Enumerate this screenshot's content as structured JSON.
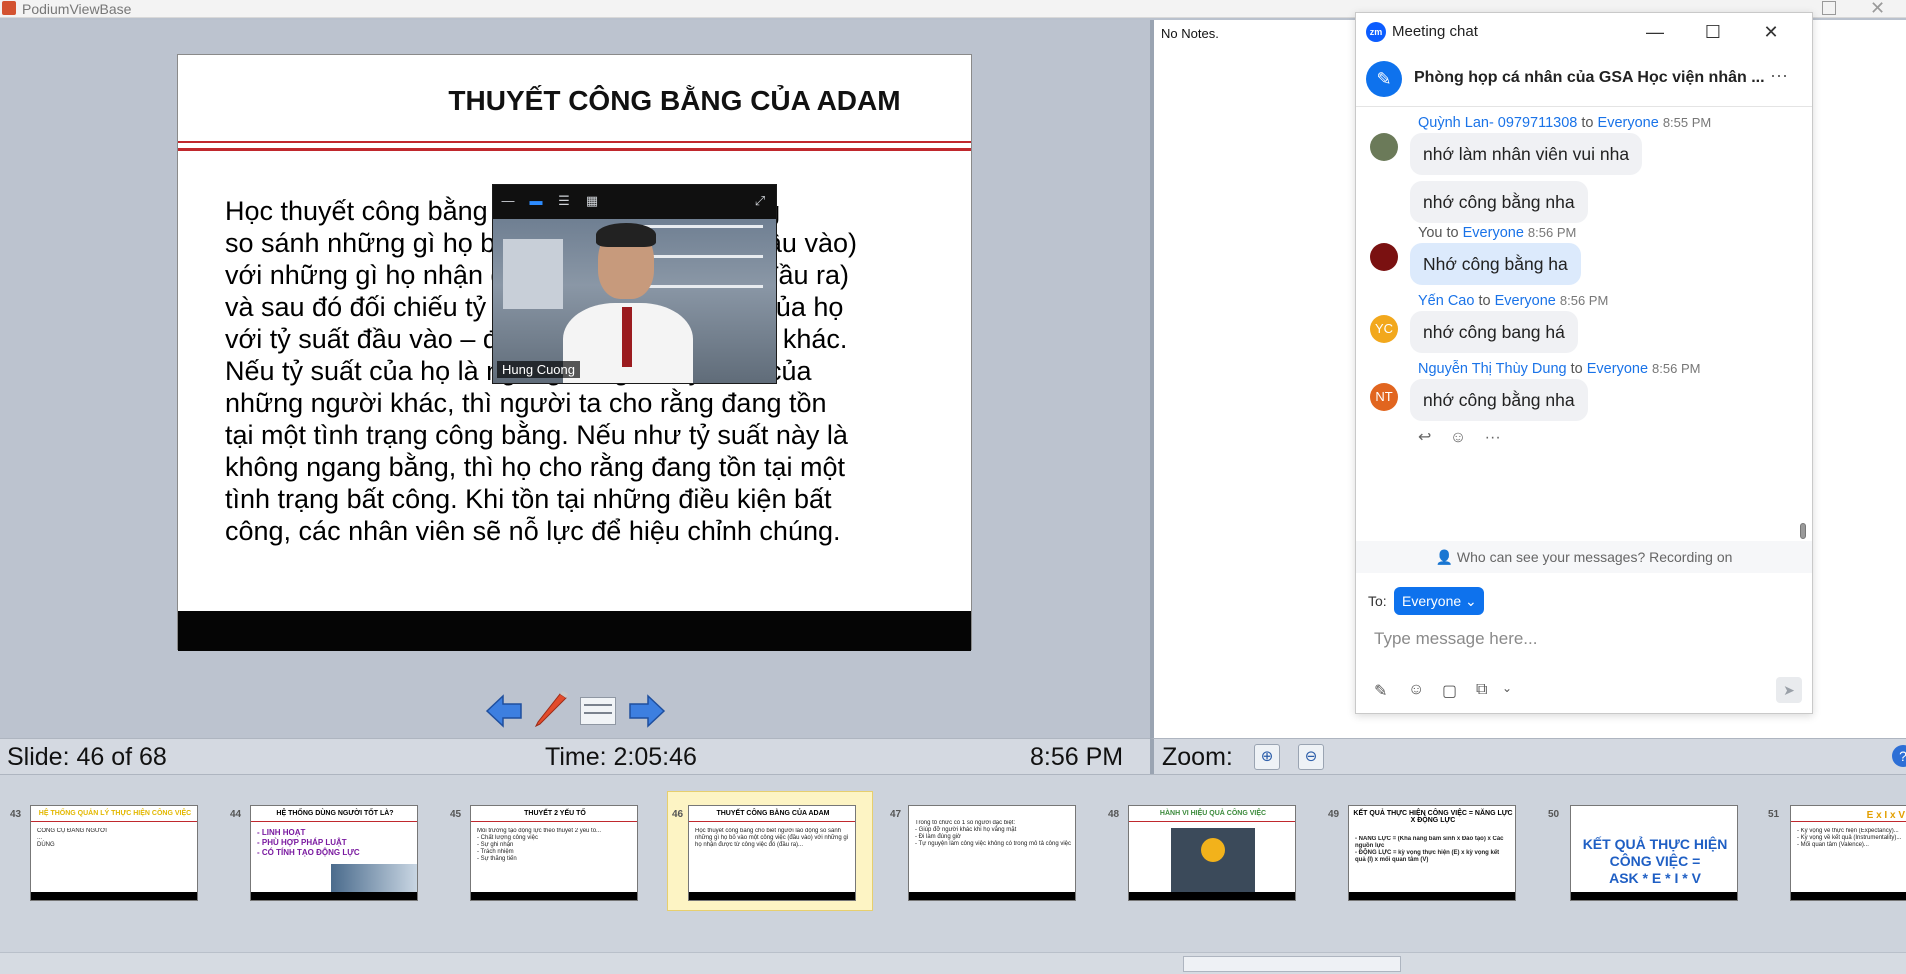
{
  "window": {
    "title": "PodiumViewBase"
  },
  "slide": {
    "title": "THUYẾT CÔNG BẰNG CỦA ADAM",
    "body": "Học thuyết công bằng cho biết người lao động\nso sánh những gì họ bỏ vào một công việc (đầu vào)\nvới những gì họ nhận được từ công việc đó (đầu ra)\nvà sau đó đối chiếu tỷ suất đầu vào – đầu ra của họ\nvới tỷ suất đầu vào – đầu ra của những người khác.\nNếu tỷ suất của họ là ngang bằng với tỷ suất của\nnhững người khác, thì người ta cho rằng đang tồn\ntại một tình trạng công bằng. Nếu như tỷ suất này là\nkhông ngang bằng, thì họ cho rằng đang tồn tại một\ntình trạng bất công. Khi tồn tại những điều kiện bất\ncông, các nhân viên sẽ nỗ lực để hiệu chỉnh chúng."
  },
  "video": {
    "participant_name": "Hung Cuong"
  },
  "status": {
    "slide_counter": "Slide: 46 of 68",
    "elapsed": "Time: 2:05:46",
    "clock": "8:56 PM"
  },
  "notes": {
    "text": "No Notes."
  },
  "zoom": {
    "label": "Zoom:"
  },
  "chat": {
    "window_title": "Meeting chat",
    "room_name": "Phòng họp cá nhân của GSA Học viện nhân ...",
    "messages": [
      {
        "sender": "Quỳnh Lan- 0979711308",
        "to": "to",
        "recipient": "Everyone",
        "time": "8:55 PM",
        "texts": [
          "nhớ làm nhân viên vui nha",
          "nhớ công bằng nha"
        ]
      },
      {
        "sender": "You",
        "to": "to",
        "recipient": "Everyone",
        "time": "8:56 PM",
        "texts": [
          "Nhớ công bằng ha"
        ]
      },
      {
        "sender": "Yến Cao",
        "to": "to",
        "recipient": "Everyone",
        "time": "8:56 PM",
        "initials": "YC",
        "texts": [
          "nhớ công bang há"
        ]
      },
      {
        "sender": "Nguyễn Thị Thùy Dung",
        "to": "to",
        "recipient": "Everyone",
        "time": "8:56 PM",
        "initials": "NT",
        "texts": [
          "nhớ công bằng nha"
        ]
      }
    ],
    "privacy_notice": "Who can see your messages? Recording on",
    "to_label": "To:",
    "recipient_select": "Everyone",
    "input_placeholder": "Type message here..."
  },
  "thumbnails": [
    {
      "num": "43",
      "title": "HỆ THỐNG QUẢN LÝ THỰC HIỆN CÔNG VIỆC",
      "body": "CÔNG CỤ ĐÁNG NGƯỜI\n...\nDÙNG"
    },
    {
      "num": "44",
      "title": "HỆ THỐNG DÙNG NGƯỜI TỐT LÀ?",
      "body": "- LINH HOẠT\n- PHÙ HỢP PHÁP LUẬT\n- CÓ TÍNH TẠO ĐỘNG LỰC"
    },
    {
      "num": "45",
      "title": "THUYẾT 2 YẾU TỐ",
      "body": "Môi trường tạo động lực theo thuyết 2 yếu tố...\n- Chất lượng công việc\n- Sự ghi nhận\n- Trách nhiệm\n- Sự thăng tiến"
    },
    {
      "num": "46",
      "title": "THUYẾT CÔNG BẰNG CỦA ADAM",
      "body": "Học thuyết công bằng cho biết người lao động so sánh những gì họ bỏ vào một công việc (đầu vào) với những gì họ nhận được từ công việc đó (đầu ra)..."
    },
    {
      "num": "47",
      "title": "",
      "body": "Trong tổ chức có 1 số người đặc biệt:\n- Giúp đỡ người khác khi họ vắng mặt\n- Đi làm đúng giờ\n- Tự nguyện làm công việc không có trong mô tả công việc"
    },
    {
      "num": "48",
      "title": "HÀNH VI HIỆU QUẢ CÔNG VIỆC",
      "body": ""
    },
    {
      "num": "49",
      "title": "KẾT QUẢ THỰC HIỆN CÔNG VIỆC = NĂNG LỰC X ĐỘNG LỰC",
      "body": "- NĂNG LỰC = (Khả năng bẩm sinh x Đào tạo) x Các nguồn lực\n- ĐỘNG LỰC = kỳ vọng thực hiện (E) x kỳ vọng kết quả (I) x mối quan tâm (V)"
    },
    {
      "num": "50",
      "title": "",
      "body": "KẾT QUẢ THỰC HIỆN CÔNG VIỆC =\nASK * E * I * V"
    },
    {
      "num": "51",
      "title": "E x I x V",
      "body": "- Kỳ vọng về thực hiện (Expectancy)...\n- Kỳ vọng về kết quả (Instrumentality)...\n- Mối quan tâm (Valence)..."
    }
  ]
}
